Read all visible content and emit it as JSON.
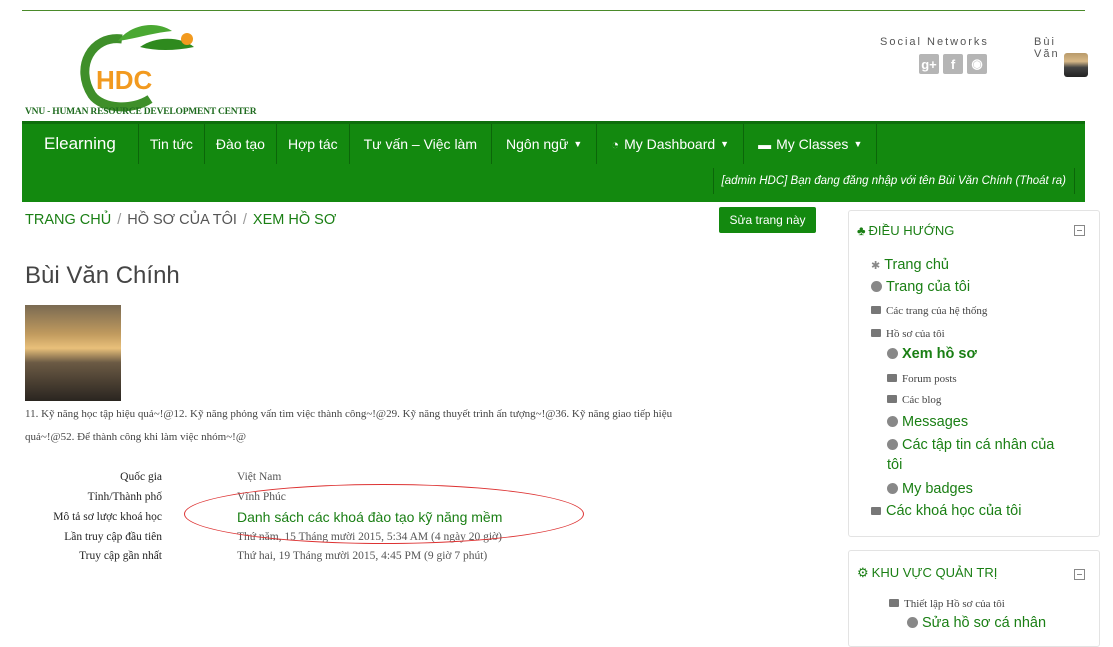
{
  "header": {
    "logo_text": "HDC",
    "logo_caption": "VNU - HUMAN RESOURCE DEVELOPMENT CENTER",
    "social_label": "Social Networks",
    "user_label": "Bùi Văn",
    "social_icons": [
      "googleplus-icon",
      "facebook-icon",
      "globe-icon"
    ],
    "social_glyphs": [
      "g+",
      "f",
      "◉"
    ]
  },
  "nav": {
    "brand": "Elearning",
    "items": [
      "Tin tức",
      "Đào tạo",
      "Hợp tác",
      "Tư vấn – Việc làm",
      "Ngôn ngữ",
      "My Dashboard",
      "My Classes"
    ],
    "login_info": "[admin HDC] Bạn đang đăng nhập với tên Bùi Văn Chính (Thoát ra)"
  },
  "breadcrumb": {
    "home": "TRANG CHỦ",
    "profile": "HỒ SƠ CỦA TÔI",
    "current": "XEM HỒ SƠ"
  },
  "edit_button": "Sửa trang này",
  "page_title": "Bùi Văn Chính",
  "description_line1": "11. Kỹ năng học tập hiệu quả~!@12. Kỹ năng phỏng vấn tìm việc thành công~!@29. Kỹ năng thuyết trình ấn tượng~!@36. Kỹ năng giao tiếp hiệu",
  "description_line2": "quả~!@52. Để thành công khi làm việc nhóm~!@",
  "info": [
    {
      "label": "Quốc gia",
      "value": "Việt Nam"
    },
    {
      "label": "Tỉnh/Thành phố",
      "value": "Vĩnh Phúc"
    },
    {
      "label": "Mô tả sơ lược khoá học",
      "value": "Danh sách các khoá đào tạo kỹ năng mềm"
    },
    {
      "label": "Lần truy cập đầu tiên",
      "value": "Thứ năm, 15 Tháng mười 2015, 5:34 AM  (4 ngày 20 giờ)"
    },
    {
      "label": "Truy cập gần nhất",
      "value": "Thứ hai, 19 Tháng mười 2015, 4:45 PM  (9 giờ 7 phút)"
    }
  ],
  "nav_block": {
    "title": "ĐIỀU HƯỚNG",
    "items": [
      "Trang chủ",
      "Trang của tôi",
      "Các trang của hệ thống",
      "Hồ sơ của tôi",
      "Xem hồ sơ",
      "Forum posts",
      "Các blog",
      "Messages",
      "Các tập tin cá nhân của",
      "tôi",
      "My badges",
      "Các khoá học của tôi"
    ]
  },
  "admin_block": {
    "title": "KHU VỰC QUẢN TRỊ",
    "items": [
      "Thiết lập Hồ sơ của tôi",
      "Sửa hồ sơ cá nhân"
    ]
  },
  "colors": {
    "brand_green": "#13890f",
    "link_green": "#1a7f14"
  }
}
